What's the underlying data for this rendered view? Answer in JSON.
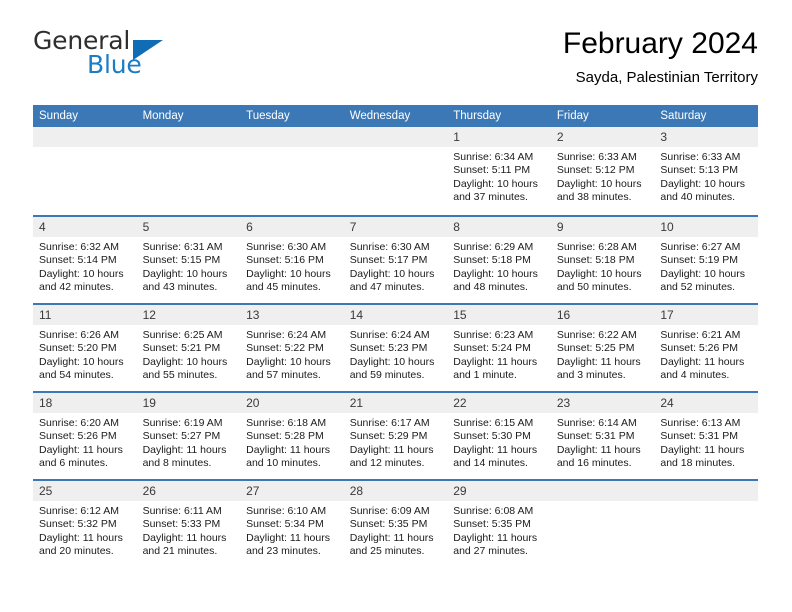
{
  "brand": {
    "name_part1": "General",
    "name_part2": "Blue"
  },
  "header": {
    "title": "February 2024",
    "subtitle": "Sayda, Palestinian Territory"
  },
  "colors": {
    "header_blue": "#3b78b5",
    "logo_blue": "#0f6cb5",
    "daynum_band": "#efefef"
  },
  "weekday_headers": [
    "Sunday",
    "Monday",
    "Tuesday",
    "Wednesday",
    "Thursday",
    "Friday",
    "Saturday"
  ],
  "weeks": [
    [
      {
        "day": "",
        "sunrise": "",
        "sunset": "",
        "daylight": ""
      },
      {
        "day": "",
        "sunrise": "",
        "sunset": "",
        "daylight": ""
      },
      {
        "day": "",
        "sunrise": "",
        "sunset": "",
        "daylight": ""
      },
      {
        "day": "",
        "sunrise": "",
        "sunset": "",
        "daylight": ""
      },
      {
        "day": "1",
        "sunrise": "Sunrise: 6:34 AM",
        "sunset": "Sunset: 5:11 PM",
        "daylight": "Daylight: 10 hours and 37 minutes."
      },
      {
        "day": "2",
        "sunrise": "Sunrise: 6:33 AM",
        "sunset": "Sunset: 5:12 PM",
        "daylight": "Daylight: 10 hours and 38 minutes."
      },
      {
        "day": "3",
        "sunrise": "Sunrise: 6:33 AM",
        "sunset": "Sunset: 5:13 PM",
        "daylight": "Daylight: 10 hours and 40 minutes."
      }
    ],
    [
      {
        "day": "4",
        "sunrise": "Sunrise: 6:32 AM",
        "sunset": "Sunset: 5:14 PM",
        "daylight": "Daylight: 10 hours and 42 minutes."
      },
      {
        "day": "5",
        "sunrise": "Sunrise: 6:31 AM",
        "sunset": "Sunset: 5:15 PM",
        "daylight": "Daylight: 10 hours and 43 minutes."
      },
      {
        "day": "6",
        "sunrise": "Sunrise: 6:30 AM",
        "sunset": "Sunset: 5:16 PM",
        "daylight": "Daylight: 10 hours and 45 minutes."
      },
      {
        "day": "7",
        "sunrise": "Sunrise: 6:30 AM",
        "sunset": "Sunset: 5:17 PM",
        "daylight": "Daylight: 10 hours and 47 minutes."
      },
      {
        "day": "8",
        "sunrise": "Sunrise: 6:29 AM",
        "sunset": "Sunset: 5:18 PM",
        "daylight": "Daylight: 10 hours and 48 minutes."
      },
      {
        "day": "9",
        "sunrise": "Sunrise: 6:28 AM",
        "sunset": "Sunset: 5:18 PM",
        "daylight": "Daylight: 10 hours and 50 minutes."
      },
      {
        "day": "10",
        "sunrise": "Sunrise: 6:27 AM",
        "sunset": "Sunset: 5:19 PM",
        "daylight": "Daylight: 10 hours and 52 minutes."
      }
    ],
    [
      {
        "day": "11",
        "sunrise": "Sunrise: 6:26 AM",
        "sunset": "Sunset: 5:20 PM",
        "daylight": "Daylight: 10 hours and 54 minutes."
      },
      {
        "day": "12",
        "sunrise": "Sunrise: 6:25 AM",
        "sunset": "Sunset: 5:21 PM",
        "daylight": "Daylight: 10 hours and 55 minutes."
      },
      {
        "day": "13",
        "sunrise": "Sunrise: 6:24 AM",
        "sunset": "Sunset: 5:22 PM",
        "daylight": "Daylight: 10 hours and 57 minutes."
      },
      {
        "day": "14",
        "sunrise": "Sunrise: 6:24 AM",
        "sunset": "Sunset: 5:23 PM",
        "daylight": "Daylight: 10 hours and 59 minutes."
      },
      {
        "day": "15",
        "sunrise": "Sunrise: 6:23 AM",
        "sunset": "Sunset: 5:24 PM",
        "daylight": "Daylight: 11 hours and 1 minute."
      },
      {
        "day": "16",
        "sunrise": "Sunrise: 6:22 AM",
        "sunset": "Sunset: 5:25 PM",
        "daylight": "Daylight: 11 hours and 3 minutes."
      },
      {
        "day": "17",
        "sunrise": "Sunrise: 6:21 AM",
        "sunset": "Sunset: 5:26 PM",
        "daylight": "Daylight: 11 hours and 4 minutes."
      }
    ],
    [
      {
        "day": "18",
        "sunrise": "Sunrise: 6:20 AM",
        "sunset": "Sunset: 5:26 PM",
        "daylight": "Daylight: 11 hours and 6 minutes."
      },
      {
        "day": "19",
        "sunrise": "Sunrise: 6:19 AM",
        "sunset": "Sunset: 5:27 PM",
        "daylight": "Daylight: 11 hours and 8 minutes."
      },
      {
        "day": "20",
        "sunrise": "Sunrise: 6:18 AM",
        "sunset": "Sunset: 5:28 PM",
        "daylight": "Daylight: 11 hours and 10 minutes."
      },
      {
        "day": "21",
        "sunrise": "Sunrise: 6:17 AM",
        "sunset": "Sunset: 5:29 PM",
        "daylight": "Daylight: 11 hours and 12 minutes."
      },
      {
        "day": "22",
        "sunrise": "Sunrise: 6:15 AM",
        "sunset": "Sunset: 5:30 PM",
        "daylight": "Daylight: 11 hours and 14 minutes."
      },
      {
        "day": "23",
        "sunrise": "Sunrise: 6:14 AM",
        "sunset": "Sunset: 5:31 PM",
        "daylight": "Daylight: 11 hours and 16 minutes."
      },
      {
        "day": "24",
        "sunrise": "Sunrise: 6:13 AM",
        "sunset": "Sunset: 5:31 PM",
        "daylight": "Daylight: 11 hours and 18 minutes."
      }
    ],
    [
      {
        "day": "25",
        "sunrise": "Sunrise: 6:12 AM",
        "sunset": "Sunset: 5:32 PM",
        "daylight": "Daylight: 11 hours and 20 minutes."
      },
      {
        "day": "26",
        "sunrise": "Sunrise: 6:11 AM",
        "sunset": "Sunset: 5:33 PM",
        "daylight": "Daylight: 11 hours and 21 minutes."
      },
      {
        "day": "27",
        "sunrise": "Sunrise: 6:10 AM",
        "sunset": "Sunset: 5:34 PM",
        "daylight": "Daylight: 11 hours and 23 minutes."
      },
      {
        "day": "28",
        "sunrise": "Sunrise: 6:09 AM",
        "sunset": "Sunset: 5:35 PM",
        "daylight": "Daylight: 11 hours and 25 minutes."
      },
      {
        "day": "29",
        "sunrise": "Sunrise: 6:08 AM",
        "sunset": "Sunset: 5:35 PM",
        "daylight": "Daylight: 11 hours and 27 minutes."
      },
      {
        "day": "",
        "sunrise": "",
        "sunset": "",
        "daylight": ""
      },
      {
        "day": "",
        "sunrise": "",
        "sunset": "",
        "daylight": ""
      }
    ]
  ]
}
